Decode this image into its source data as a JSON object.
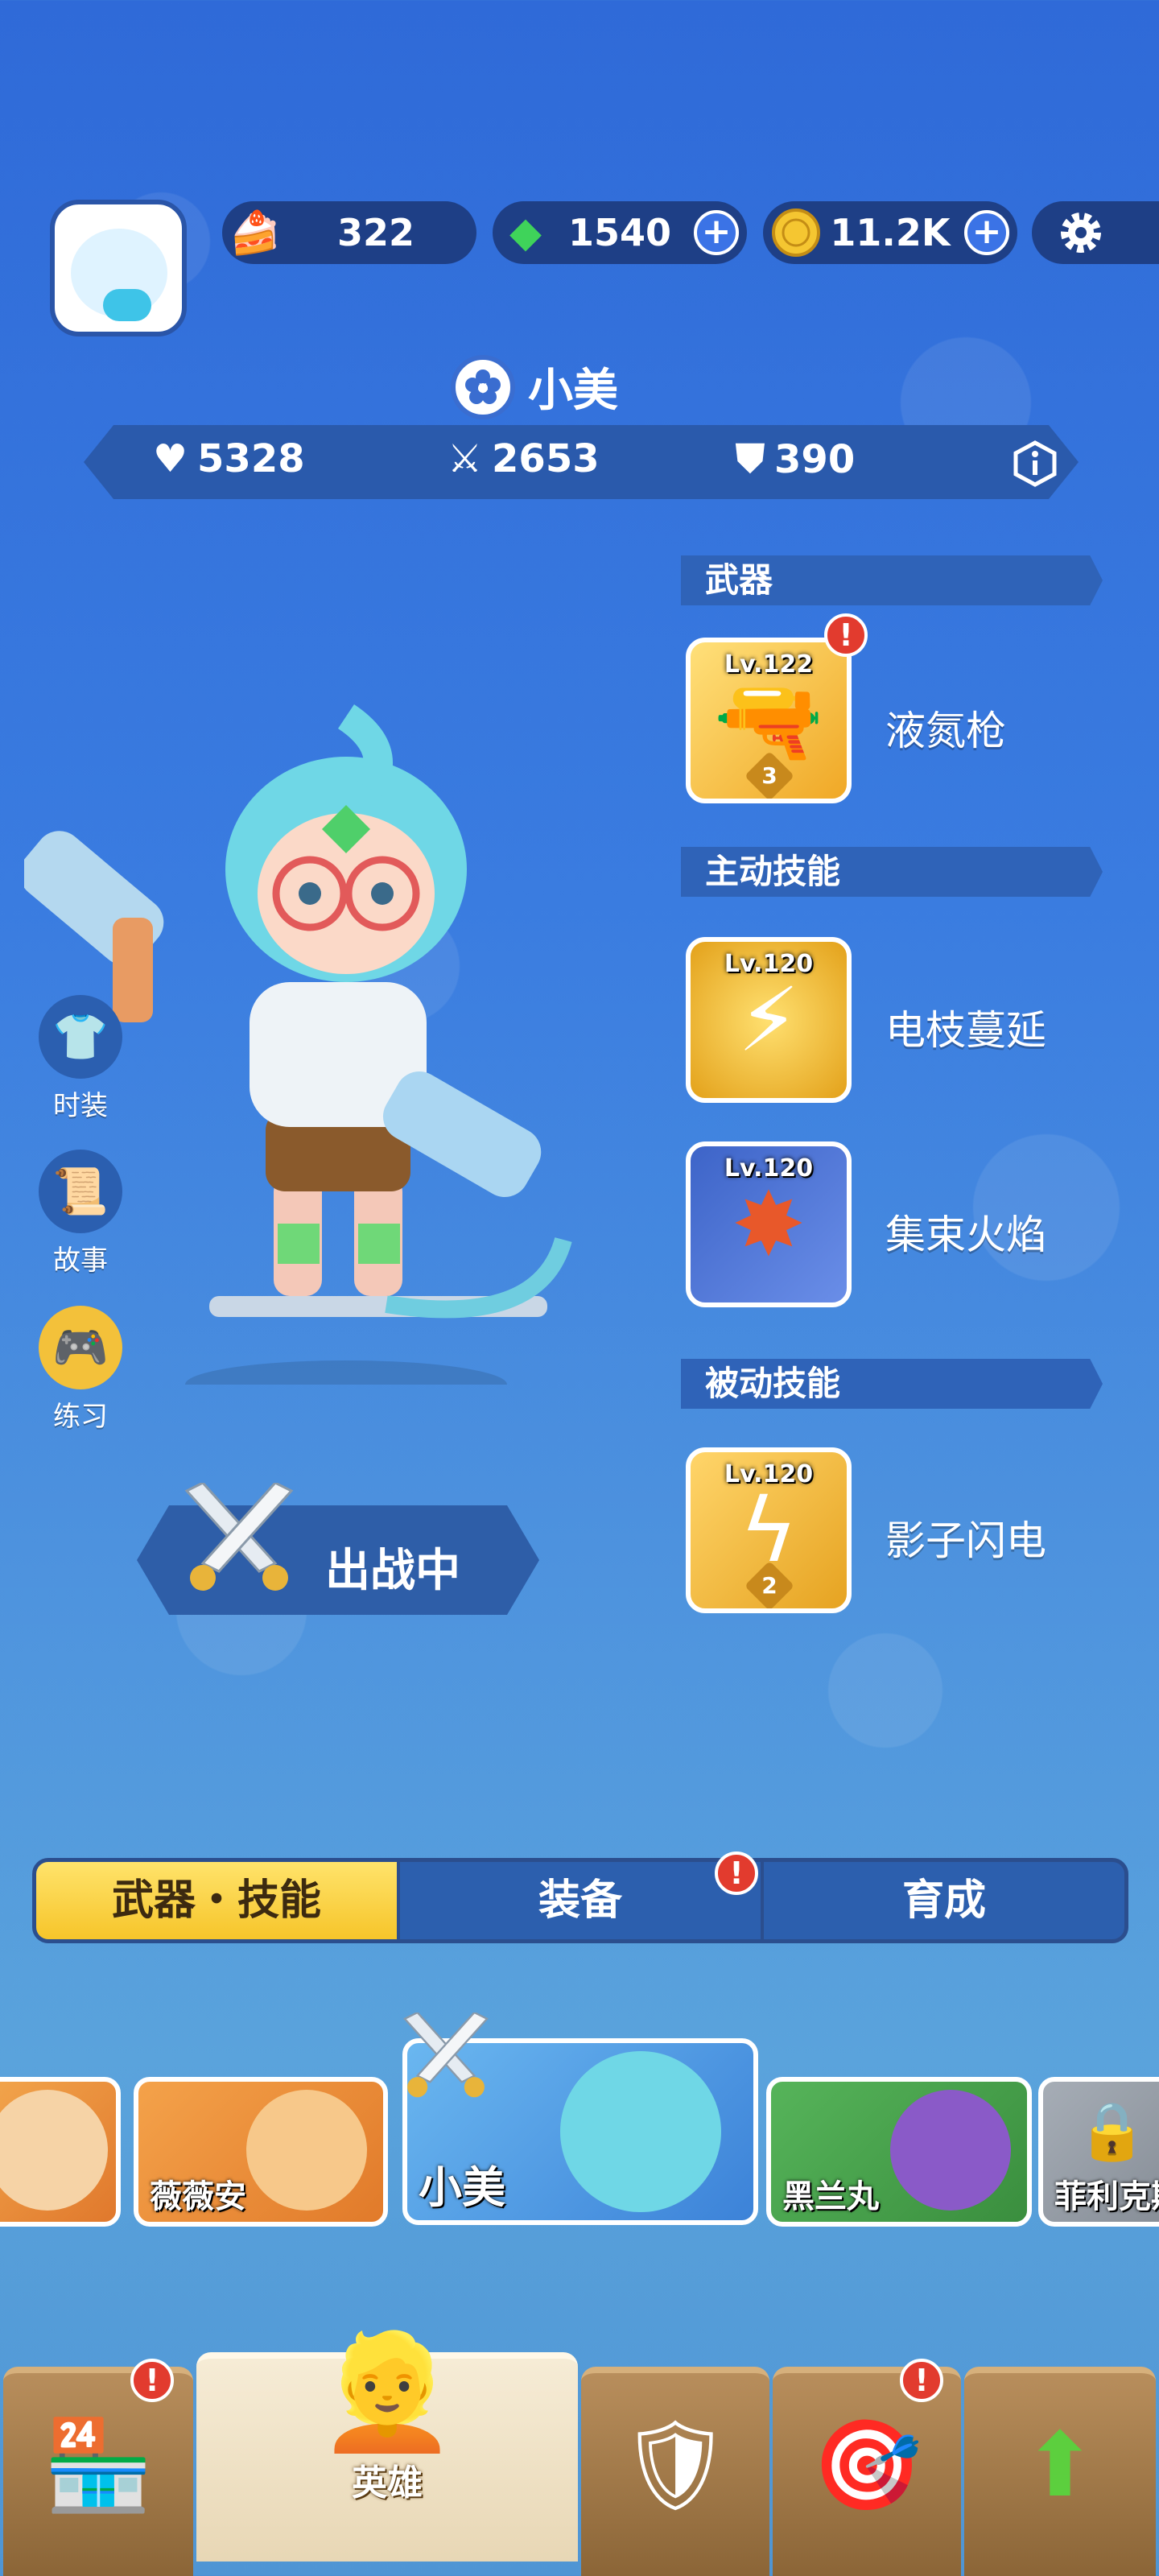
{
  "resources": {
    "cake": {
      "icon": "cake-icon",
      "value": "322"
    },
    "gems": {
      "icon": "gem-icon",
      "value": "1540"
    },
    "coins": {
      "icon": "coin-icon",
      "value": "11.2K"
    }
  },
  "hero": {
    "name": "小美",
    "stats": {
      "hp": "5328",
      "attack": "2653",
      "defense": "390"
    }
  },
  "sections": {
    "weapon": "武器",
    "active_skill": "主动技能",
    "passive_skill": "被动技能"
  },
  "skills": [
    {
      "name": "液氮枪",
      "level": "Lv.122",
      "stars": "3",
      "alert": "!"
    },
    {
      "name": "电枝蔓延",
      "level": "Lv.120"
    },
    {
      "name": "集束火焰",
      "level": "Lv.120"
    },
    {
      "name": "影子闪电",
      "level": "Lv.120",
      "stars": "2"
    }
  ],
  "side_buttons": [
    "时装",
    "故事",
    "练习"
  ],
  "deploy_label": "出战中",
  "tabs": [
    "武器・技能",
    "装备",
    "育成"
  ],
  "tab_alert": "!",
  "hero_cards": [
    "",
    "薇薇安",
    "小美",
    "黑兰丸",
    "菲利克斯"
  ],
  "bottom_nav": {
    "hero_label": "英雄",
    "alert": "!"
  },
  "colors": {
    "accent": "#f6c52a",
    "alert": "#e23b2e",
    "panel": "#2c5fae"
  }
}
